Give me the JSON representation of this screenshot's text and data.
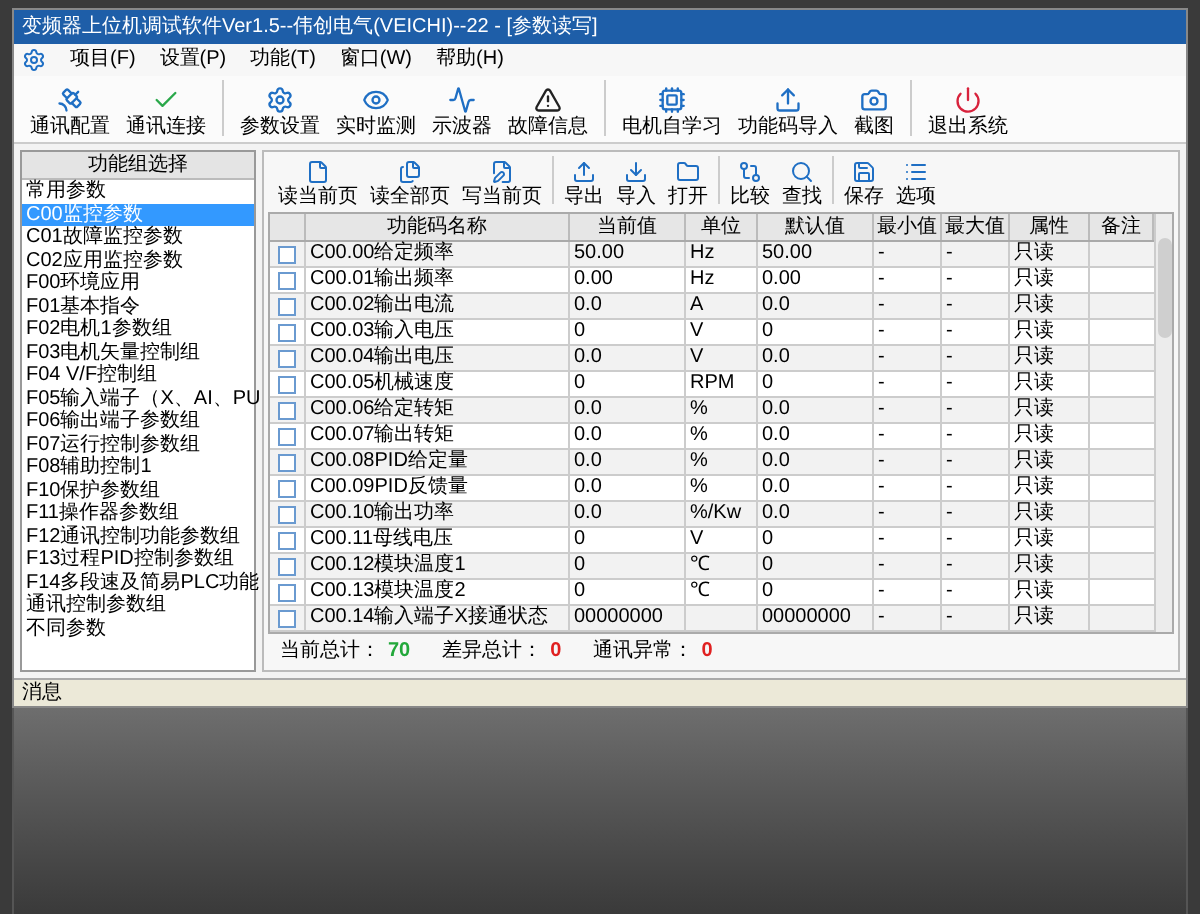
{
  "window": {
    "title": "变频器上位机调试软件Ver1.5--伟创电气(VEICHI)--22 - [参数读写]"
  },
  "menu": [
    "项目(F)",
    "设置(P)",
    "功能(T)",
    "窗口(W)",
    "帮助(H)"
  ],
  "toolbar": [
    {
      "label": "通讯配置",
      "kind": "dish"
    },
    {
      "label": "通讯连接",
      "kind": "check"
    },
    {
      "label": "参数设置",
      "kind": "gear",
      "group_start": true
    },
    {
      "label": "实时监测",
      "kind": "eye"
    },
    {
      "label": "示波器",
      "kind": "wave"
    },
    {
      "label": "故障信息",
      "kind": "warning"
    },
    {
      "label": "电机自学习",
      "kind": "motor",
      "group_start": true
    },
    {
      "label": "功能码导入",
      "kind": "upload"
    },
    {
      "label": "截图",
      "kind": "camera"
    },
    {
      "label": "退出系统",
      "kind": "power",
      "group_start": true
    }
  ],
  "sidebar": {
    "title": "功能组选择",
    "items": [
      {
        "label": "常用参数",
        "selected": false
      },
      {
        "label": "C00监控参数",
        "selected": true
      },
      {
        "label": "C01故障监控参数",
        "selected": false
      },
      {
        "label": "C02应用监控参数",
        "selected": false
      },
      {
        "label": "F00环境应用",
        "selected": false
      },
      {
        "label": "F01基本指令",
        "selected": false
      },
      {
        "label": "F02电机1参数组",
        "selected": false
      },
      {
        "label": "F03电机矢量控制组",
        "selected": false
      },
      {
        "label": "F04 V/F控制组",
        "selected": false
      },
      {
        "label": "F05输入端子（X、AI、PU",
        "selected": false
      },
      {
        "label": "F06输出端子参数组",
        "selected": false
      },
      {
        "label": "F07运行控制参数组",
        "selected": false
      },
      {
        "label": "F08辅助控制1",
        "selected": false
      },
      {
        "label": "F10保护参数组",
        "selected": false
      },
      {
        "label": "F11操作器参数组",
        "selected": false
      },
      {
        "label": "F12通讯控制功能参数组",
        "selected": false
      },
      {
        "label": "F13过程PID控制参数组",
        "selected": false
      },
      {
        "label": "F14多段速及简易PLC功能",
        "selected": false
      },
      {
        "label": "通讯控制参数组",
        "selected": false
      },
      {
        "label": "不同参数",
        "selected": false
      }
    ]
  },
  "subtoolbar": [
    {
      "label": "读当前页",
      "kind": "file"
    },
    {
      "label": "读全部页",
      "kind": "files"
    },
    {
      "label": "写当前页",
      "kind": "pen"
    },
    {
      "label": "导出",
      "kind": "export",
      "group_start": true
    },
    {
      "label": "导入",
      "kind": "import"
    },
    {
      "label": "打开",
      "kind": "folder"
    },
    {
      "label": "比较",
      "kind": "compare",
      "group_start": true
    },
    {
      "label": "查找",
      "kind": "find"
    },
    {
      "label": "保存",
      "kind": "save",
      "group_start": true
    },
    {
      "label": "选项",
      "kind": "list"
    }
  ],
  "table": {
    "columns": [
      "功能码名称",
      "当前值",
      "单位",
      "默认值",
      "最小值",
      "最大值",
      "属性",
      "备注"
    ],
    "rows": [
      {
        "checked": false,
        "name": "C00.00给定频率",
        "current": "50.00",
        "unit": "Hz",
        "default": "50.00",
        "min": "-",
        "max": "-",
        "attribute": "只读"
      },
      {
        "checked": false,
        "name": "C00.01输出频率",
        "current": "0.00",
        "unit": "Hz",
        "default": "0.00",
        "min": "-",
        "max": "-",
        "attribute": "只读"
      },
      {
        "checked": false,
        "name": "C00.02输出电流",
        "current": "0.0",
        "unit": "A",
        "default": "0.0",
        "min": "-",
        "max": "-",
        "attribute": "只读"
      },
      {
        "checked": false,
        "name": "C00.03输入电压",
        "current": "0",
        "unit": "V",
        "default": "0",
        "min": "-",
        "max": "-",
        "attribute": "只读"
      },
      {
        "checked": false,
        "name": "C00.04输出电压",
        "current": "0.0",
        "unit": "V",
        "default": "0.0",
        "min": "-",
        "max": "-",
        "attribute": "只读"
      },
      {
        "checked": false,
        "name": "C00.05机械速度",
        "current": "0",
        "unit": "RPM",
        "default": "0",
        "min": "-",
        "max": "-",
        "attribute": "只读"
      },
      {
        "checked": false,
        "name": "C00.06给定转矩",
        "current": "0.0",
        "unit": "%",
        "default": "0.0",
        "min": "-",
        "max": "-",
        "attribute": "只读"
      },
      {
        "checked": false,
        "name": "C00.07输出转矩",
        "current": "0.0",
        "unit": "%",
        "default": "0.0",
        "min": "-",
        "max": "-",
        "attribute": "只读"
      },
      {
        "checked": false,
        "name": "C00.08PID给定量",
        "current": "0.0",
        "unit": "%",
        "default": "0.0",
        "min": "-",
        "max": "-",
        "attribute": "只读"
      },
      {
        "checked": false,
        "name": "C00.09PID反馈量",
        "current": "0.0",
        "unit": "%",
        "default": "0.0",
        "min": "-",
        "max": "-",
        "attribute": "只读"
      },
      {
        "checked": false,
        "name": "C00.10输出功率",
        "current": "0.0",
        "unit": "%/Kw",
        "default": "0.0",
        "min": "-",
        "max": "-",
        "attribute": "只读"
      },
      {
        "checked": false,
        "name": "C00.11母线电压",
        "current": "0",
        "unit": "V",
        "default": "0",
        "min": "-",
        "max": "-",
        "attribute": "只读"
      },
      {
        "checked": false,
        "name": "C00.12模块温度1",
        "current": "0",
        "unit": "℃",
        "default": "0",
        "min": "-",
        "max": "-",
        "attribute": "只读"
      },
      {
        "checked": false,
        "name": "C00.13模块温度2",
        "current": "0",
        "unit": "℃",
        "default": "0",
        "min": "-",
        "max": "-",
        "attribute": "只读"
      },
      {
        "checked": false,
        "name": "C00.14输入端子X接通状态",
        "current": "00000000",
        "default": "00000000",
        "min": "-",
        "max": "-",
        "attribute": "只读"
      }
    ]
  },
  "status": [
    {
      "label": "当前总计：",
      "value": "70",
      "color": "#22a83a"
    },
    {
      "label": "差异总计：",
      "value": "0",
      "color": "#e02020"
    },
    {
      "label": "通讯异常：",
      "value": "0",
      "color": "#e02020"
    }
  ],
  "messages": {
    "title": "消息"
  }
}
